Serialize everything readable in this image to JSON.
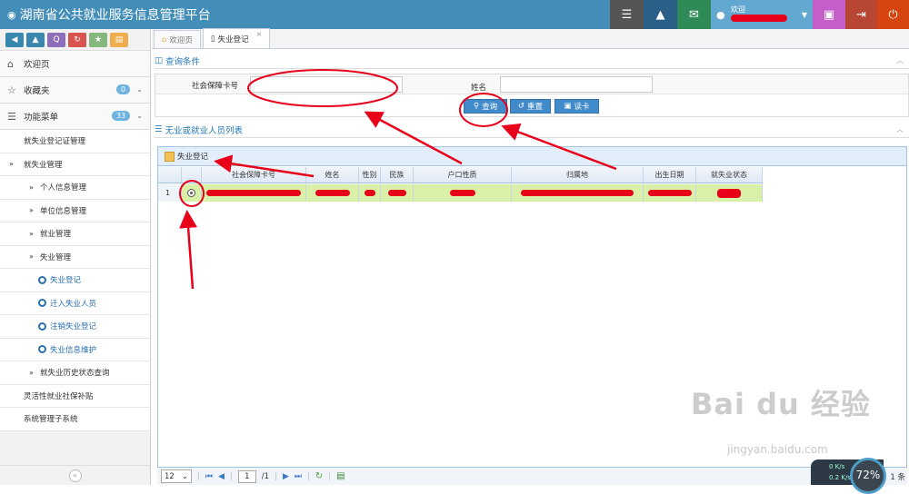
{
  "app": {
    "title": "湖南省公共就业服务信息管理平台",
    "welcome": "欢迎"
  },
  "shortcuts": [
    "‹",
    "^",
    "Q",
    "↻",
    "★",
    "▭"
  ],
  "shortcut_colors": [
    "#3a87ad",
    "#3a87ad",
    "#8c6fb8",
    "#d9534f",
    "#87b87f",
    "#f0ad4e"
  ],
  "topbar_buttons": [
    {
      "name": "tasks-icon",
      "glyph": "☰",
      "color": "#555"
    },
    {
      "name": "bell-icon",
      "glyph": "🔔",
      "color": "#2a5f87"
    },
    {
      "name": "mail-icon",
      "glyph": "✉",
      "color": "#2e8b57"
    }
  ],
  "topbar_right": [
    {
      "name": "lock-icon",
      "glyph": "🔒",
      "color": "#c65ec9"
    },
    {
      "name": "logout-icon",
      "glyph": "⇥",
      "color": "#b74635"
    },
    {
      "name": "power-icon",
      "glyph": "⏻",
      "color": "#d64510"
    }
  ],
  "sidebar": {
    "home": "欢迎页",
    "favorites": "收藏夹",
    "favorites_count": "0",
    "menu": "功能菜单",
    "menu_count": "33",
    "items": [
      {
        "label": "就失业登记证管理",
        "level": 1
      },
      {
        "label": "就失业管理",
        "level": 1,
        "expanded": true
      },
      {
        "label": "个人信息管理",
        "level": 2
      },
      {
        "label": "单位信息管理",
        "level": 2
      },
      {
        "label": "就业管理",
        "level": 2
      },
      {
        "label": "失业管理",
        "level": 2,
        "expanded": true
      },
      {
        "label": "失业登记",
        "level": 3
      },
      {
        "label": "迁入失业人员",
        "level": 3
      },
      {
        "label": "注销失业登记",
        "level": 3
      },
      {
        "label": "失业信息维护",
        "level": 3
      },
      {
        "label": "就失业历史状态查询",
        "level": 2
      },
      {
        "label": "灵活性就业社保补贴",
        "level": 1
      },
      {
        "label": "系统管理子系统",
        "level": 1
      }
    ],
    "collapse": "«"
  },
  "tabs": [
    {
      "label": "欢迎页",
      "active": false
    },
    {
      "label": "失业登记",
      "active": true
    }
  ],
  "query": {
    "title": "查询条件",
    "ssn_label": "社会保障卡号",
    "ssn_value": "",
    "name_label": "姓名",
    "name_value": "",
    "search": "查询",
    "reset": "重置",
    "read_card": "读卡"
  },
  "list": {
    "title": "无业或就业人员列表",
    "toolbar_button": "失业登记",
    "columns": [
      "社会保障卡号",
      "姓名",
      "性别",
      "民族",
      "户口性质",
      "归属地",
      "出生日期",
      "就失业状态"
    ],
    "row_number": "1"
  },
  "pager": {
    "page_size": "12",
    "page": "1",
    "total_pages": "/1",
    "records": "1 条"
  },
  "overlay": {
    "watermark": "Bai du 经验",
    "watermark_url": "jingyan.baidu.com",
    "gauge": "72%",
    "net_up": "0 K/s",
    "net_down": "0.2 K/s"
  }
}
